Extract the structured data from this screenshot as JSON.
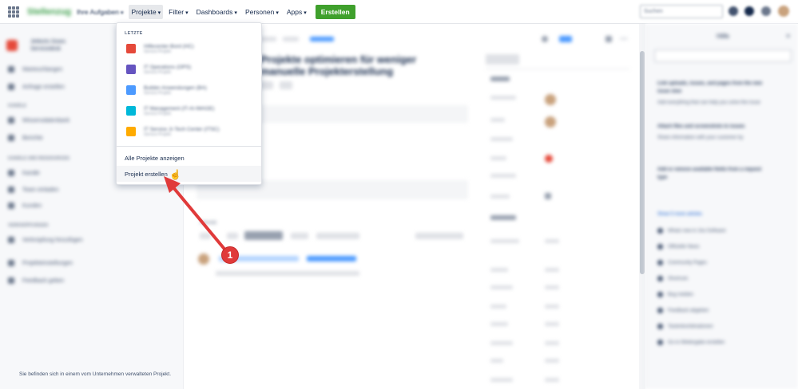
{
  "topnav": {
    "logo": "Stellenzug",
    "items": [
      {
        "label": "Ihre Aufgaben",
        "blurred": true
      },
      {
        "label": "Projekte",
        "active": true
      },
      {
        "label": "Filter"
      },
      {
        "label": "Dashboards"
      },
      {
        "label": "Personen"
      },
      {
        "label": "Apps"
      }
    ],
    "create_label": "Erstellen",
    "search_placeholder": "Suchen"
  },
  "sidebar": {
    "project_name": "Jettezts Gows",
    "project_type": "Servicedesk",
    "items": [
      "Warteschlangen",
      "Anfrage erstellen",
      "Wissensdatenbank",
      "Berichte",
      "Kanäle",
      "Team einladen",
      "Kunden",
      "Verknüpfung hinzufügen",
      "Projekteinstellungen",
      "Feedback geben"
    ],
    "headings": [
      "KANÄLE",
      "KANÄLE UND RESSOURCEN",
      "VERKNÜPFUNGEN"
    ],
    "footer": "Sie befinden sich in einem vom Unternehmen verwalteten Projekt."
  },
  "issue": {
    "title": "Projekte optimieren für weniger manuelle Projekterstellung",
    "status": "Offen"
  },
  "help": {
    "title": "Hilfe",
    "search_placeholder": "Search help articles",
    "lines": [
      "Link uploads, issues, and pages from the new",
      "issue view",
      "Add everything that can help you solve the issue",
      "Attach files and screenshots to issues",
      "Share information with your customer by",
      "Add or remove available fields from a request",
      "type"
    ],
    "show_more": "Show 5 more articles",
    "links": [
      "Whats new in Jira Software",
      "Offizielle News",
      "Community Pages",
      "Shortcuts",
      "Bug melden",
      "Feedback abgeben",
      "Tastenkombinationen",
      "Go to Weitergabe erstellen"
    ]
  },
  "dropdown": {
    "header": "LETZTE",
    "recent": [
      {
        "name": "Hilfecenter-Bord (HC)",
        "type": "Service-Projekt",
        "color": "#e5493a"
      },
      {
        "name": "IT Operations (OPS)",
        "type": "Service-Projekt",
        "color": "#6554c0"
      },
      {
        "name": "Builder-Anwendungen (BA)",
        "type": "Service-Projekt",
        "color": "#4c9aff"
      },
      {
        "name": "IT Management (IT-AI-IMAGE)",
        "type": "Service-Projekt",
        "color": "#00b8d9"
      },
      {
        "name": "IT Service Jr-Tech Center (ITSC)",
        "type": "Service-Projekt",
        "color": "#ffab00"
      }
    ],
    "all_projects": "Alle Projekte anzeigen",
    "create_project": "Projekt erstellen"
  },
  "annotation": {
    "step": "1",
    "color": "#e03a3a"
  }
}
